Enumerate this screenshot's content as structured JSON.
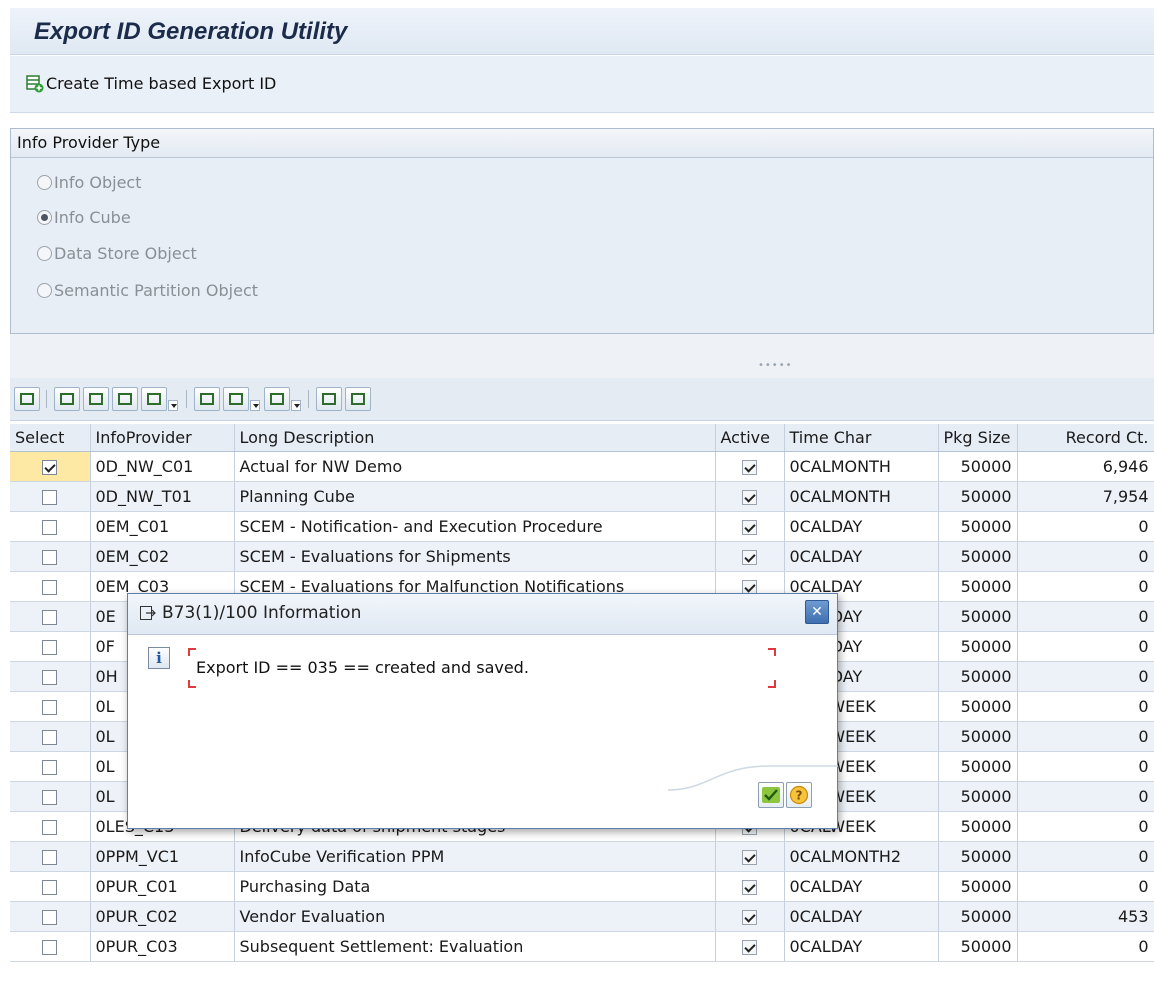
{
  "title": "Export ID Generation Utility",
  "app_toolbar": {
    "create_label": "Create Time based Export ID",
    "create_icon": "create-export-icon"
  },
  "provider_group": {
    "header": "Info Provider Type",
    "options": [
      {
        "label": "Info Object",
        "selected": false
      },
      {
        "label": "Info Cube",
        "selected": true
      },
      {
        "label": "Data Store Object",
        "selected": false
      },
      {
        "label": "Semantic Partition Object",
        "selected": false
      }
    ]
  },
  "grid_toolbar": {
    "icons": [
      "details-icon",
      "sort-ascending-icon",
      "sort-descending-icon",
      "find-icon",
      "filter-icon",
      "print-icon",
      "views-icon",
      "export-icon",
      "select-layout-icon",
      "save-layout-icon"
    ]
  },
  "table": {
    "columns": [
      "Select",
      "InfoProvider",
      "Long Description",
      "Active",
      "Time Char",
      "Pkg Size",
      "Record Ct."
    ],
    "rows": [
      {
        "select": true,
        "provider": "0D_NW_C01",
        "desc": "Actual for NW Demo",
        "active": true,
        "time": "0CALMONTH",
        "pkg": "50000",
        "records": "6,946"
      },
      {
        "select": false,
        "provider": "0D_NW_T01",
        "desc": "Planning Cube",
        "active": true,
        "time": "0CALMONTH",
        "pkg": "50000",
        "records": "7,954"
      },
      {
        "select": false,
        "provider": "0EM_C01",
        "desc": "SCEM - Notification- and Execution Procedure",
        "active": true,
        "time": "0CALDAY",
        "pkg": "50000",
        "records": "0"
      },
      {
        "select": false,
        "provider": "0EM_C02",
        "desc": "SCEM - Evaluations for Shipments",
        "active": true,
        "time": "0CALDAY",
        "pkg": "50000",
        "records": "0"
      },
      {
        "select": false,
        "provider": "0EM_C03",
        "desc": "SCEM - Evaluations for Malfunction Notifications",
        "active": true,
        "time": "0CALDAY",
        "pkg": "50000",
        "records": "0"
      },
      {
        "select": false,
        "provider": "0E",
        "desc": "",
        "active": true,
        "time": "0CALDAY",
        "pkg": "50000",
        "records": "0"
      },
      {
        "select": false,
        "provider": "0F",
        "desc": "",
        "active": true,
        "time": "0CALDAY",
        "pkg": "50000",
        "records": "0"
      },
      {
        "select": false,
        "provider": "0H",
        "desc": "",
        "active": true,
        "time": "0CALDAY",
        "pkg": "50000",
        "records": "0"
      },
      {
        "select": false,
        "provider": "0L",
        "desc": "",
        "active": true,
        "time": "0CALWEEK",
        "pkg": "50000",
        "records": "0"
      },
      {
        "select": false,
        "provider": "0L",
        "desc": "",
        "active": true,
        "time": "0CALWEEK",
        "pkg": "50000",
        "records": "0"
      },
      {
        "select": false,
        "provider": "0L",
        "desc": "",
        "active": true,
        "time": "0CALWEEK",
        "pkg": "50000",
        "records": "0"
      },
      {
        "select": false,
        "provider": "0L",
        "desc": "",
        "active": true,
        "time": "0CALWEEK",
        "pkg": "50000",
        "records": "0"
      },
      {
        "select": false,
        "provider": "0LES_C13",
        "desc": "Delivery data of shipment stages",
        "active": true,
        "time": "0CALWEEK",
        "pkg": "50000",
        "records": "0"
      },
      {
        "select": false,
        "provider": "0PPM_VC1",
        "desc": "InfoCube Verification PPM",
        "active": true,
        "time": "0CALMONTH2",
        "pkg": "50000",
        "records": "0"
      },
      {
        "select": false,
        "provider": "0PUR_C01",
        "desc": "Purchasing Data",
        "active": true,
        "time": "0CALDAY",
        "pkg": "50000",
        "records": "0"
      },
      {
        "select": false,
        "provider": "0PUR_C02",
        "desc": "Vendor Evaluation",
        "active": true,
        "time": "0CALDAY",
        "pkg": "50000",
        "records": "453"
      },
      {
        "select": false,
        "provider": "0PUR_C03",
        "desc": "Subsequent Settlement: Evaluation",
        "active": true,
        "time": "0CALDAY",
        "pkg": "50000",
        "records": "0"
      }
    ]
  },
  "dialog": {
    "title": "B73(1)/100 Information",
    "message": "Export ID == 035 == created and saved.",
    "ok_icon": "confirm-check-icon",
    "help_icon": "help-icon"
  }
}
